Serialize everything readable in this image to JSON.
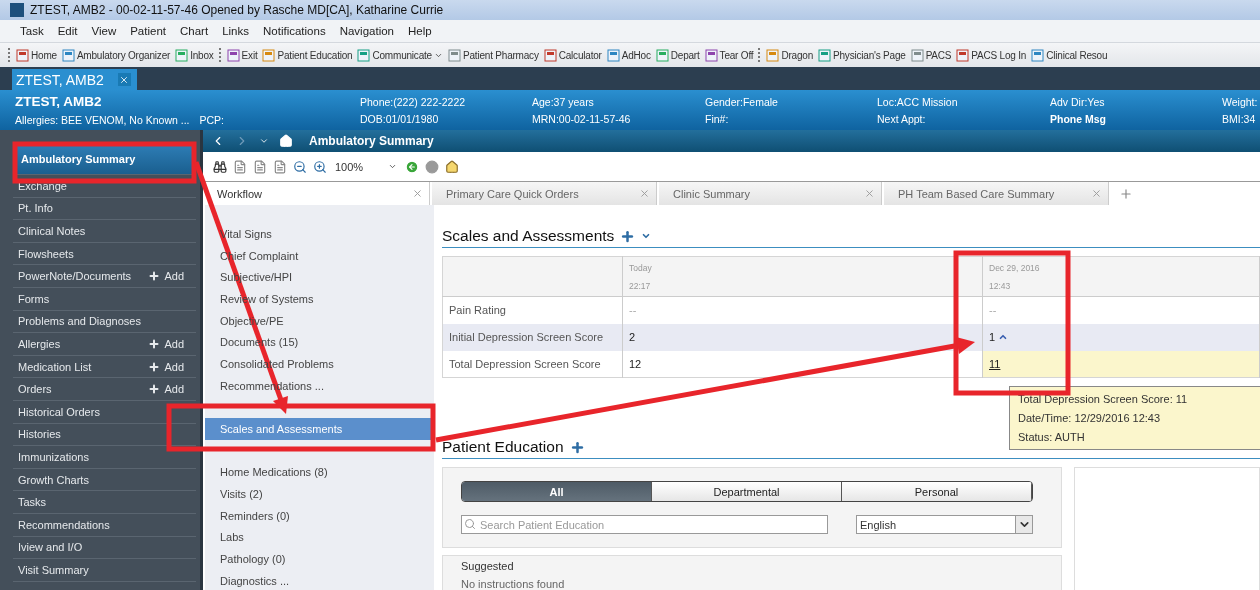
{
  "window": {
    "title": "ZTEST, AMB2 - 00-02-11-57-46 Opened by Rasche MD[CA], Katharine Currie"
  },
  "menu": [
    "Task",
    "Edit",
    "View",
    "Patient",
    "Chart",
    "Links",
    "Notifications",
    "Navigation",
    "Help"
  ],
  "toolbar_groups": [
    [
      {
        "label": "Home",
        "kind": "button"
      },
      {
        "label": "Ambulatory Organizer",
        "kind": "button"
      },
      {
        "label": "Inbox",
        "kind": "button"
      }
    ],
    [
      {
        "label": "Exit",
        "kind": "button"
      },
      {
        "label": "Patient Education",
        "kind": "button"
      },
      {
        "label": "Communicate",
        "kind": "menu"
      },
      {
        "label": "Patient Pharmacy",
        "kind": "button"
      },
      {
        "label": "Calculator",
        "kind": "button"
      },
      {
        "label": "AdHoc",
        "kind": "button"
      },
      {
        "label": "Depart",
        "kind": "button"
      },
      {
        "label": "Tear Off",
        "kind": "button"
      }
    ],
    [
      {
        "label": "Dragon",
        "kind": "button"
      },
      {
        "label": "Physician's Page",
        "kind": "button"
      },
      {
        "label": "PACS",
        "kind": "button"
      },
      {
        "label": "PACS Log In",
        "kind": "button"
      },
      {
        "label": "Clinical Resou",
        "kind": "button"
      }
    ]
  ],
  "patient_tab": {
    "label": "ZTEST, AMB2"
  },
  "banner": {
    "name": "ZTEST, AMB2",
    "allergies": "Allergies: BEE VENOM, No Known ...",
    "pcp": "PCP:",
    "columns": [
      {
        "top": "Phone:(222) 222-2222",
        "bottom": "DOB:01/01/1980",
        "bottom_bold": false
      },
      {
        "top": "Age:37 years",
        "bottom": "MRN:00-02-11-57-46",
        "bottom_bold": false
      },
      {
        "top": "Gender:Female",
        "bottom": "Fin#:",
        "bottom_bold": false
      },
      {
        "top": "Loc:ACC Mission",
        "bottom": "Next Appt:",
        "bottom_bold": false
      },
      {
        "top": "Adv Dir:Yes",
        "bottom": "Phone Msg",
        "bottom_bold": true
      },
      {
        "top": "Weight:",
        "bottom": "BMI:34",
        "bottom_bold": false
      }
    ]
  },
  "sidebar": {
    "items": [
      {
        "label": "Ambulatory Summary",
        "selected": true
      },
      {
        "label": "Exchange",
        "selected": false
      },
      {
        "label": "Pt. Info",
        "selected": false
      },
      {
        "label": "Clinical Notes",
        "selected": false
      },
      {
        "label": "Flowsheets",
        "selected": false
      },
      {
        "label": "PowerNote/Documents",
        "selected": false,
        "add": "Add"
      },
      {
        "label": "Forms",
        "selected": false
      },
      {
        "label": "Problems and Diagnoses",
        "selected": false
      },
      {
        "label": "Allergies",
        "selected": false,
        "add": "Add"
      },
      {
        "label": "Medication List",
        "selected": false,
        "add": "Add"
      },
      {
        "label": "Orders",
        "selected": false,
        "add": "Add"
      },
      {
        "label": "Historical Orders",
        "selected": false
      },
      {
        "label": "Histories",
        "selected": false
      },
      {
        "label": "Immunizations",
        "selected": false
      },
      {
        "label": "Growth Charts",
        "selected": false
      },
      {
        "label": "Tasks",
        "selected": false
      },
      {
        "label": "Recommendations",
        "selected": false
      },
      {
        "label": "Iview and I/O",
        "selected": false
      },
      {
        "label": "Visit Summary",
        "selected": false
      }
    ]
  },
  "page_header": {
    "title": "Ambulatory Summary"
  },
  "zoom": "100%",
  "view_tabs": [
    {
      "label": "Workflow",
      "selected": true
    },
    {
      "label": "Primary Care Quick Orders",
      "selected": false
    },
    {
      "label": "Clinic Summary",
      "selected": false
    },
    {
      "label": "PH Team Based Care Summary",
      "selected": false
    }
  ],
  "workflow": {
    "items": [
      {
        "label": "Vital Signs",
        "selected": false,
        "hidden_item_before": false
      },
      {
        "label": "Chief Complaint",
        "selected": false,
        "hidden_item_before": false
      },
      {
        "label": "Subjective/HPI",
        "selected": false,
        "hidden_item_before": false
      },
      {
        "label": "Review of Systems",
        "selected": false,
        "hidden_item_before": false
      },
      {
        "label": "Objective/PE",
        "selected": false,
        "hidden_item_before": false
      },
      {
        "label": "Documents (15)",
        "selected": false,
        "hidden_item_before": false
      },
      {
        "label": "Consolidated Problems",
        "selected": false,
        "hidden_item_before": false
      },
      {
        "label": "Recommendations ...",
        "selected": false,
        "hidden_item_before": false
      },
      {
        "label": "Scales and Assessments",
        "selected": true,
        "hidden_item_before": true
      },
      {
        "label": "Home Medications (8)",
        "selected": false,
        "hidden_item_before": true
      },
      {
        "label": "Visits (2)",
        "selected": false,
        "hidden_item_before": false
      },
      {
        "label": "Reminders (0)",
        "selected": false,
        "hidden_item_before": false
      },
      {
        "label": "Labs",
        "selected": false,
        "hidden_item_before": false
      },
      {
        "label": "Pathology (0)",
        "selected": false,
        "hidden_item_before": false
      },
      {
        "label": "Diagnostics ...",
        "selected": false,
        "hidden_item_before": false
      }
    ]
  },
  "scales": {
    "title": "Scales and Assessments",
    "columns": [
      {
        "date": "Today",
        "time": "22:17"
      },
      {
        "date": "Dec 29, 2016",
        "time": "12:43"
      }
    ],
    "rows": [
      {
        "label": "Pain Rating",
        "shaded": false,
        "cells": [
          {
            "text": "--",
            "muted": true,
            "trend_up": false,
            "link": false,
            "selected": false
          },
          {
            "text": "--",
            "muted": true,
            "trend_up": false,
            "link": false,
            "selected": false
          }
        ]
      },
      {
        "label": "Initial Depression Screen Score",
        "shaded": true,
        "cells": [
          {
            "text": "2",
            "muted": false,
            "trend_up": false,
            "link": false,
            "selected": false
          },
          {
            "text": "1",
            "muted": false,
            "trend_up": true,
            "link": false,
            "selected": false
          }
        ]
      },
      {
        "label": "Total Depression Screen Score",
        "shaded": false,
        "cells": [
          {
            "text": "12",
            "muted": false,
            "trend_up": false,
            "link": false,
            "selected": false
          },
          {
            "text": "11",
            "muted": false,
            "trend_up": false,
            "link": true,
            "selected": true
          }
        ]
      }
    ]
  },
  "tooltip": {
    "lines": [
      {
        "label": "Total Depression Screen Score:",
        "value": "11"
      },
      {
        "label": "Date/Time:",
        "value": "12/29/2016 12:43"
      },
      {
        "label": "Status:",
        "value": "AUTH"
      }
    ]
  },
  "education": {
    "title": "Patient Education",
    "filters": [
      {
        "label": "All",
        "selected": true
      },
      {
        "label": "Departmental",
        "selected": false
      },
      {
        "label": "Personal",
        "selected": false
      }
    ],
    "search": {
      "placeholder": "Search Patient Education"
    },
    "language": "English",
    "suggested": {
      "title": "Suggested",
      "message": "No instructions found"
    }
  }
}
